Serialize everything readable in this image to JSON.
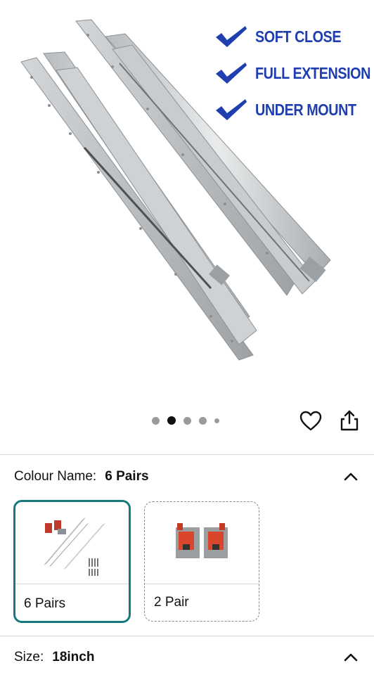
{
  "features": [
    {
      "text": "SOFT CLOSE",
      "icon": "check-icon"
    },
    {
      "text": "FULL EXTENSION",
      "icon": "check-icon"
    },
    {
      "text": "UNDER MOUNT",
      "icon": "check-icon"
    }
  ],
  "carousel": {
    "count": 5,
    "active_index": 1
  },
  "icons": {
    "favorite": "heart-icon",
    "share": "share-icon",
    "collapse": "chevron-up-icon"
  },
  "colour": {
    "label": "Colour Name:",
    "value": "6 Pairs",
    "options": [
      {
        "label": "6 Pairs",
        "selected": true
      },
      {
        "label": "2 Pair",
        "selected": false
      }
    ]
  },
  "size": {
    "label": "Size:",
    "value": "18inch"
  },
  "colors": {
    "accent_check": "#1f3fb0",
    "selected_border": "#187a7f",
    "divider": "#d5d9d9"
  }
}
